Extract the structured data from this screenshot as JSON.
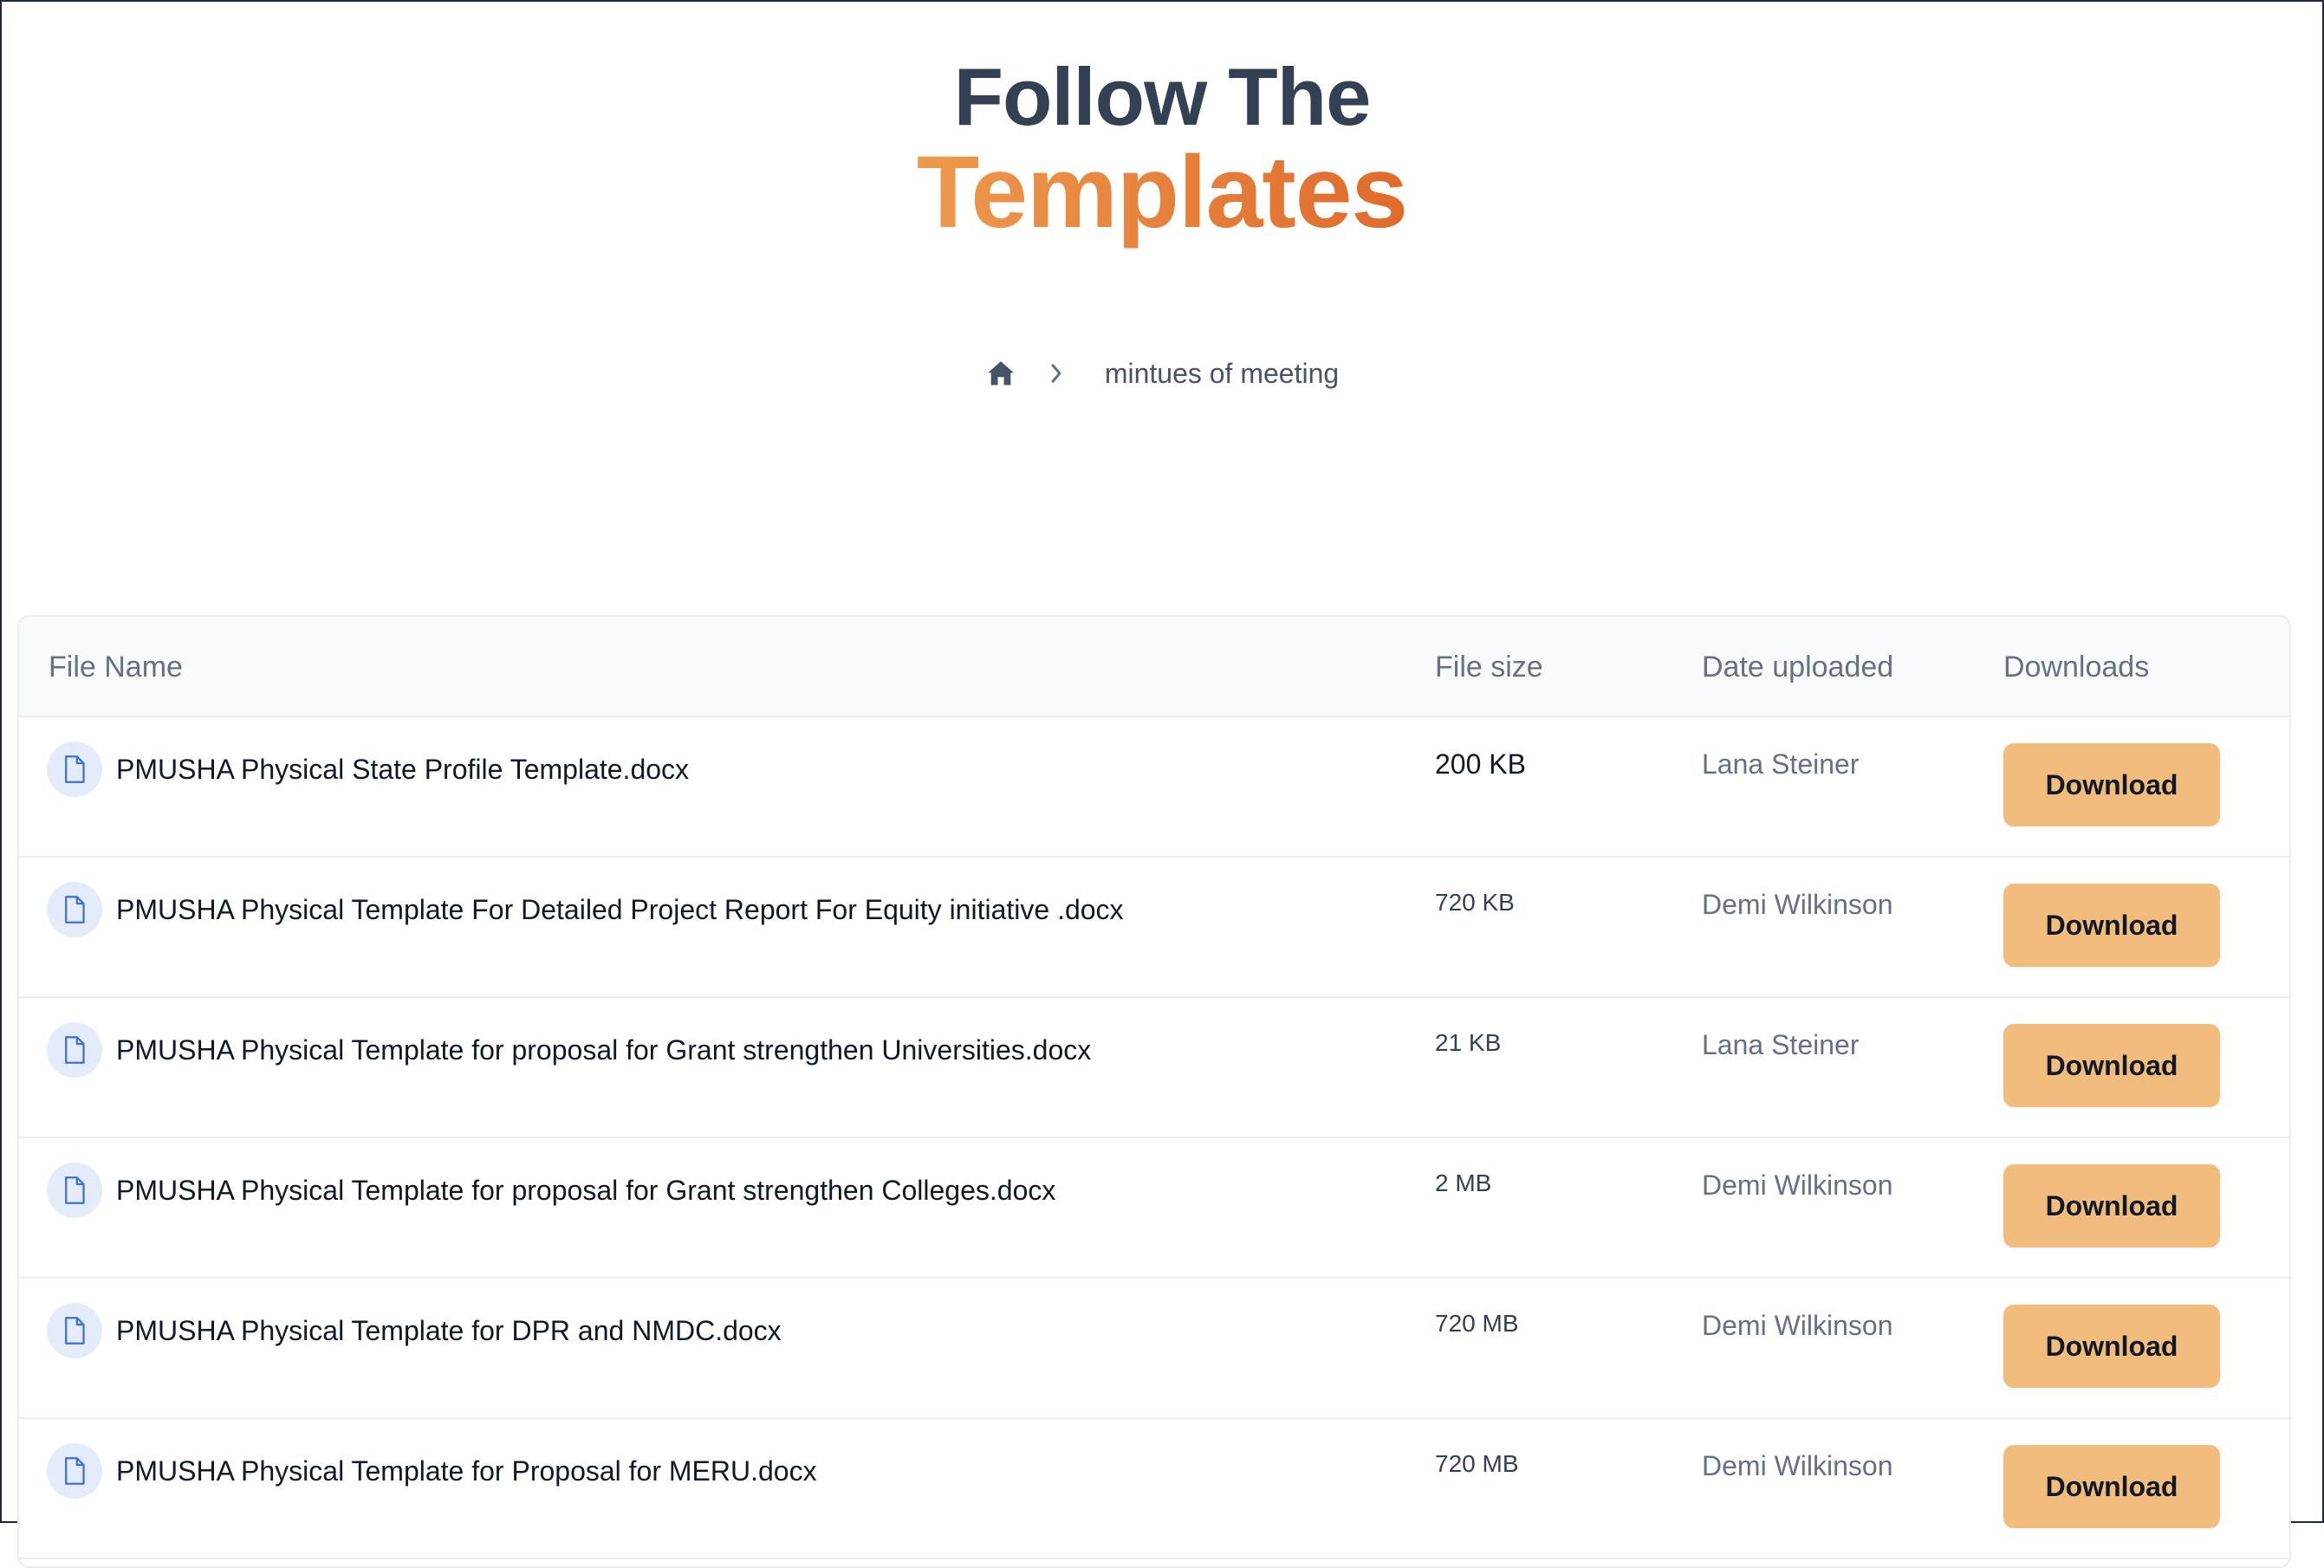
{
  "hero": {
    "line1": "Follow The",
    "line2": "Templates"
  },
  "breadcrumb": {
    "home_icon": "home-icon",
    "separator_icon": "chevron-right-icon",
    "current": "mintues of meeting"
  },
  "table": {
    "headers": {
      "file_name": "File Name",
      "file_size": "File size",
      "date_uploaded": "Date uploaded",
      "downloads": "Downloads"
    },
    "rows": [
      {
        "name": "PMUSHA Physical State Profile Template.docx",
        "size": "200 KB",
        "uploader": "Lana Steiner",
        "button": "Download"
      },
      {
        "name": "PMUSHA Physical Template For Detailed Project Report For Equity initiative .docx",
        "size": "720 KB",
        "uploader": "Demi Wilkinson",
        "button": "Download"
      },
      {
        "name": "PMUSHA Physical Template for proposal for Grant strengthen Universities.docx",
        "size": "21 KB",
        "uploader": "Lana Steiner",
        "button": "Download"
      },
      {
        "name": "PMUSHA Physical Template for proposal for Grant strengthen Colleges.docx",
        "size": "2 MB",
        "uploader": "Demi Wilkinson",
        "button": "Download"
      },
      {
        "name": "PMUSHA Physical Template for DPR and NMDC.docx",
        "size": "720 MB",
        "uploader": "Demi Wilkinson",
        "button": "Download"
      },
      {
        "name": "PMUSHA Physical Template for Proposal for MERU.docx",
        "size": "720 MB",
        "uploader": "Demi Wilkinson",
        "button": "Download"
      }
    ]
  },
  "colors": {
    "heading": "#344054",
    "accent_start": "#ed9a4d",
    "accent_end": "#e06a2c",
    "button_bg": "#f2bc7c",
    "file_icon_bg": "#e4ecfb",
    "file_icon_stroke": "#3b6fe0"
  }
}
